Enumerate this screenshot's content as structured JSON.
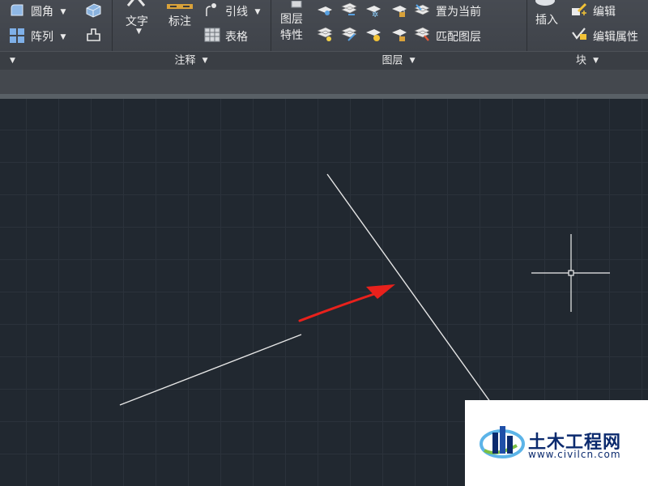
{
  "ribbon": {
    "modify_panel": {
      "fillet_label": "圆角",
      "array_label": "阵列"
    },
    "annotation_panel": {
      "text_label": "文字",
      "dimension_label": "标注",
      "leader_label": "引线",
      "table_label": "表格",
      "footer_label": "注释"
    },
    "layers_panel": {
      "layer_properties_line1": "图层",
      "layer_properties_line2": "特性",
      "set_current_label": "置为当前",
      "match_layer_label": "匹配图层",
      "footer_label": "图层"
    },
    "block_panel": {
      "insert_label": "插入",
      "edit_label": "编辑",
      "edit_attributes_label": "编辑属性",
      "footer_label": "块"
    }
  },
  "watermark": {
    "site_name": "土木工程网",
    "url": "www.civilcn.com"
  },
  "colors": {
    "canvas_bg": "#212830",
    "line_color": "#e6e6e6",
    "arrow_color": "#e8211c"
  }
}
